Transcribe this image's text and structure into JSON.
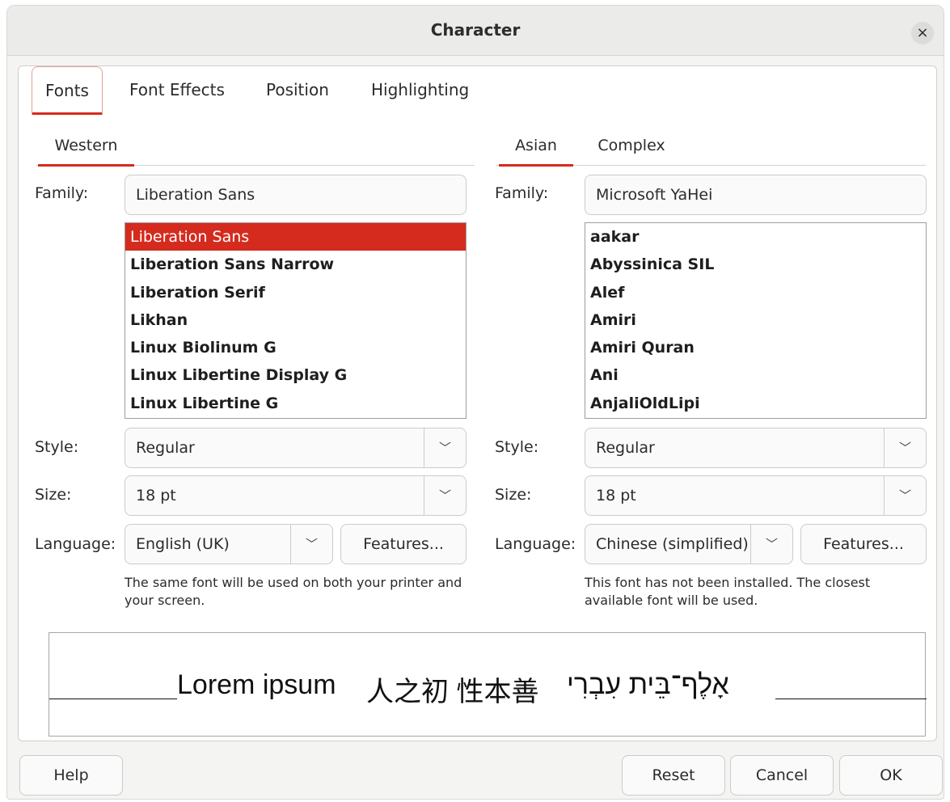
{
  "window": {
    "title": "Character",
    "close_label": "×"
  },
  "tabs": [
    {
      "label": "Fonts",
      "active": true
    },
    {
      "label": "Font Effects",
      "active": false
    },
    {
      "label": "Position",
      "active": false
    },
    {
      "label": "Highlighting",
      "active": false
    }
  ],
  "western": {
    "subtab": "Western",
    "family_label": "Family:",
    "family_value": "Liberation Sans",
    "font_list": [
      "Liberation Sans",
      "Liberation Sans Narrow",
      "Liberation Serif",
      "Likhan",
      "Linux Biolinum G",
      "Linux Libertine Display G",
      "Linux Libertine G"
    ],
    "selected_font": "Liberation Sans",
    "style_label": "Style:",
    "style_value": "Regular",
    "size_label": "Size:",
    "size_value": "18 pt",
    "language_label": "Language:",
    "language_value": "English (UK)",
    "features_label": "Features...",
    "note": "The same font will be used on both your printer and your screen."
  },
  "asian": {
    "subtab_asian": "Asian",
    "subtab_complex": "Complex",
    "family_label": "Family:",
    "family_value": "Microsoft YaHei",
    "font_list": [
      "aakar",
      "Abyssinica SIL",
      "Alef",
      "Amiri",
      "Amiri Quran",
      "Ani",
      "AnjaliOldLipi"
    ],
    "style_label": "Style:",
    "style_value": "Regular",
    "size_label": "Size:",
    "size_value": "18 pt",
    "language_label": "Language:",
    "language_value": "Chinese (simplified)",
    "features_label": "Features...",
    "note": "This font has not been installed. The closest available font will be used."
  },
  "preview": {
    "western_text": "Lorem ipsum",
    "asian_text": "人之初 性本善",
    "complex_text": "אָלֶף־בֵּית עִבְרִי"
  },
  "buttons": {
    "help": "Help",
    "reset": "Reset",
    "cancel": "Cancel",
    "ok": "OK"
  },
  "colors": {
    "accent": "#d52b1e",
    "dialog_bg": "#f4f4f3",
    "titlebar_bg": "#ebebea"
  },
  "icons": {
    "close": "close-icon",
    "dropdown": "chevron-down-icon"
  }
}
